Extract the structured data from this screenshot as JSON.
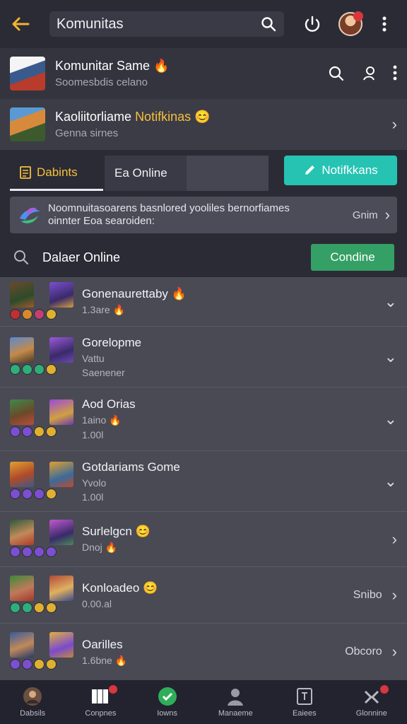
{
  "topbar": {
    "search_value": "Komunitas"
  },
  "community": {
    "title": "Komunitar Same",
    "subtitle": "Soomesbdis celano",
    "marker": "🔥"
  },
  "featured": {
    "title": "Kaoliitorliame",
    "highlight": "Notifkinas",
    "subtitle": "Genna sirnes"
  },
  "tabs": {
    "tab1": "Dabints",
    "tab2": "Ea Online",
    "notify_button": "Notifkkans"
  },
  "banner": {
    "text_line1": "Noomnuitasoarens basnlored yooliles bernorfiames",
    "text_line2": "oinnter Eoa searoiden:",
    "link": "Gnim"
  },
  "online": {
    "label": "Dalaer Online",
    "button": "Condine"
  },
  "games": [
    {
      "title": "Gonenaurettaby",
      "sub1": "1.3are",
      "sub2": "",
      "status": "",
      "dots": [
        "#c03030",
        "#d98a2b",
        "#c04070",
        "#e0b030"
      ]
    },
    {
      "title": "Gorelopme",
      "sub1": "Vattu",
      "sub2": "Saenener",
      "status": "",
      "dots": [
        "#2fae7a",
        "#2fae7a",
        "#2fae7a",
        "#e0b030"
      ]
    },
    {
      "title": "Aod Orias",
      "sub1": "1aino",
      "sub2": "1.00l",
      "status": "",
      "dots": [
        "#7b4fcf",
        "#7b4fcf",
        "#e0b030",
        "#e0b030"
      ]
    },
    {
      "title": "Gotdariams Gome",
      "sub1": "Yvolo",
      "sub2": "1.00l",
      "status": "",
      "dots": [
        "#7b4fcf",
        "#7b4fcf",
        "#7b4fcf",
        "#e0b030"
      ]
    },
    {
      "title": "Surlelgcn",
      "sub1": "Dnoj",
      "sub2": "",
      "status": "",
      "dots": [
        "#7b4fcf",
        "#7b4fcf",
        "#7b4fcf",
        "#7b4fcf"
      ]
    },
    {
      "title": "Konloadeo",
      "sub1": "0.00.al",
      "sub2": "",
      "status": "Snibo",
      "dots": [
        "#2fae7a",
        "#2fae7a",
        "#e0b030",
        "#e0b030"
      ]
    },
    {
      "title": "Oarilles",
      "sub1": "1.6bne",
      "sub2": "",
      "status": "Obcoro",
      "dots": [
        "#7b4fcf",
        "#7b4fcf",
        "#e0b030",
        "#e0b030"
      ]
    }
  ],
  "bottomnav": [
    {
      "label": "Dabsils",
      "icon": "avatar-icon"
    },
    {
      "label": "Conpnes",
      "icon": "cards-icon"
    },
    {
      "label": "Iowns",
      "icon": "check-icon"
    },
    {
      "label": "Manaeme",
      "icon": "person-icon"
    },
    {
      "label": "Eaiees",
      "icon": "tablet-icon"
    },
    {
      "label": "Glonnine",
      "icon": "puzzle-icon"
    }
  ],
  "colors": {
    "accent_yellow": "#f5c03a",
    "teal": "#26c3b3",
    "green": "#35a065",
    "badge_red": "#d9363e"
  }
}
